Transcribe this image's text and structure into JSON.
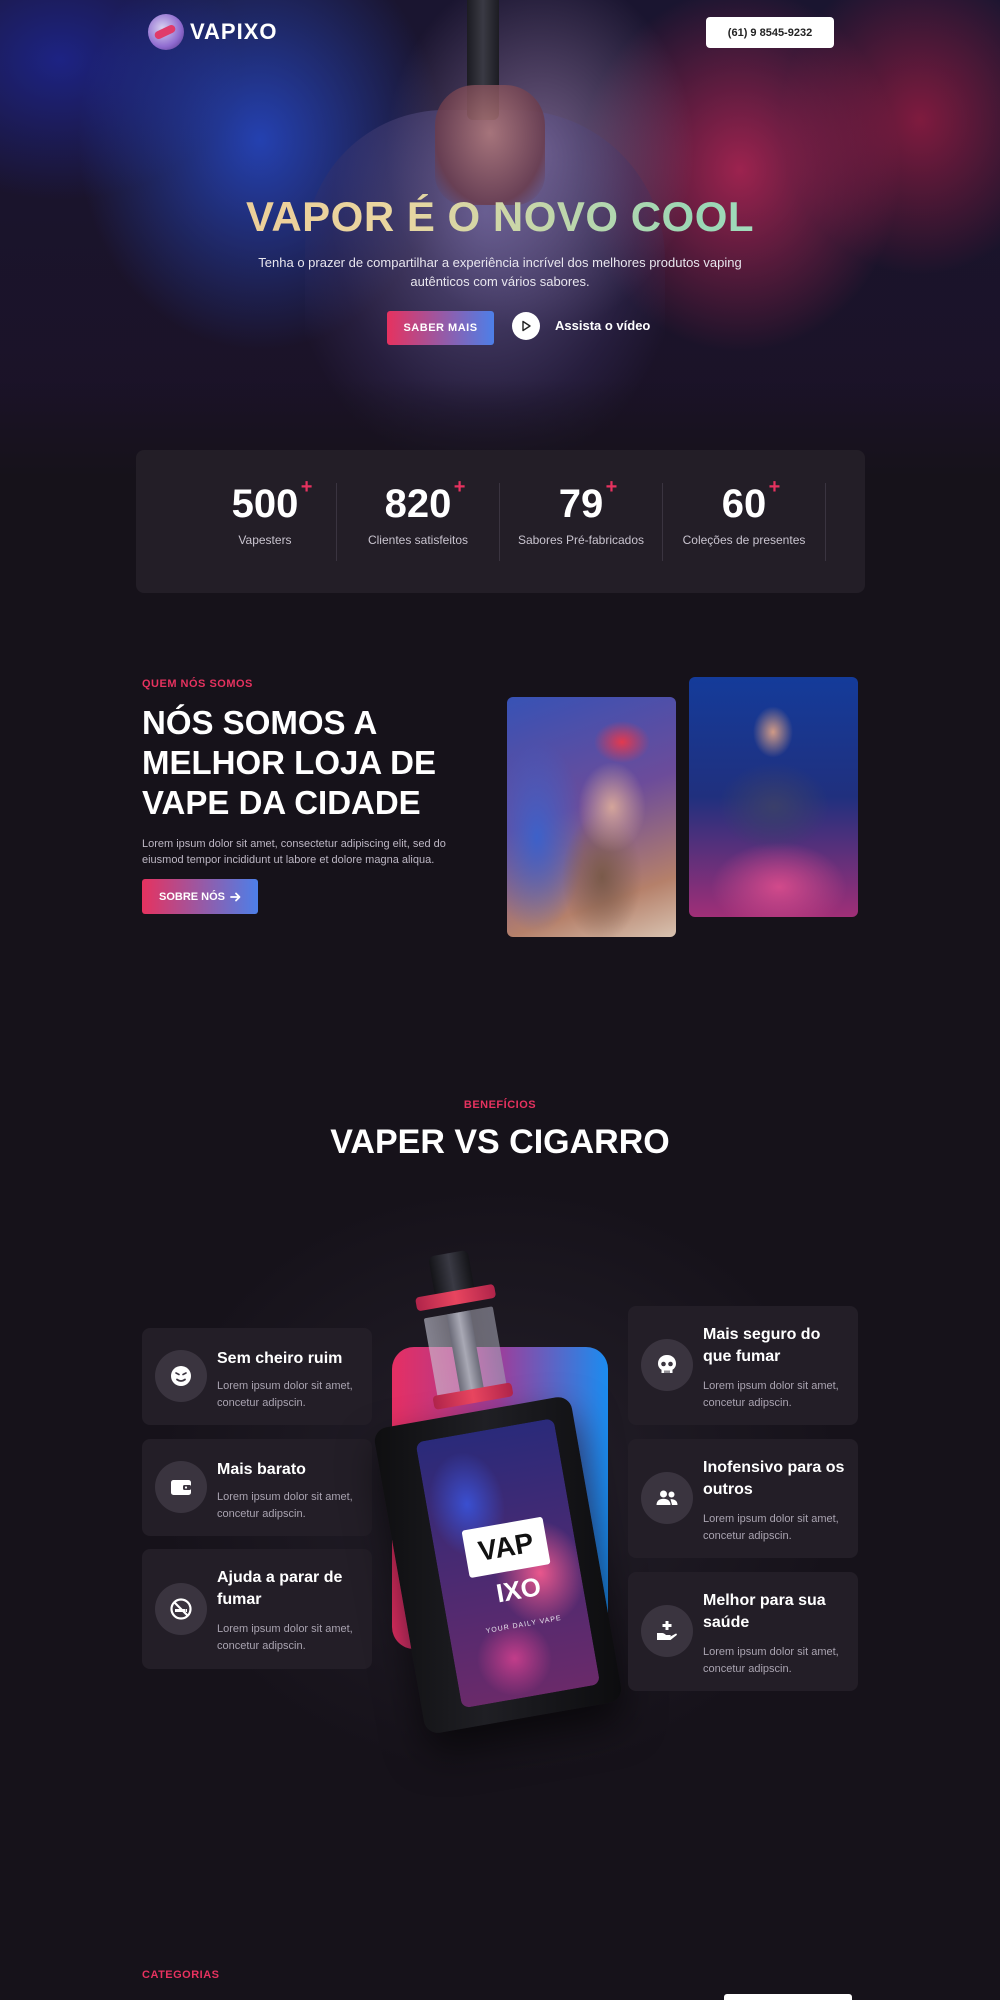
{
  "brand": {
    "name": "VAPIXO",
    "phone": "(61) 9 8545-9232"
  },
  "hero": {
    "title": "VAPOR É O NOVO COOL",
    "subtitle": "Tenha o prazer de compartilhar a experiência incrível dos melhores produtos vaping autênticos com vários sabores.",
    "cta_label": "SABER MAIS",
    "video_label": "Assista o vídeo"
  },
  "stats": [
    {
      "value": "500",
      "suffix": "+",
      "label": "Vapesters"
    },
    {
      "value": "820",
      "suffix": "+",
      "label": "Clientes satisfeitos"
    },
    {
      "value": "79",
      "suffix": "+",
      "label": "Sabores Pré-fabricados"
    },
    {
      "value": "60",
      "suffix": "+",
      "label": "Coleções de presentes"
    }
  ],
  "about": {
    "eyebrow": "QUEM NÓS SOMOS",
    "title": "NÓS SOMOS A MELHOR LOJA DE VAPE DA CIDADE",
    "text": "Lorem ipsum dolor sit amet, consectetur adipiscing elit, sed do eiusmod tempor incididunt ut labore et dolore magna aliqua.",
    "button_label": "SOBRE NÓS"
  },
  "benefits": {
    "eyebrow": "BENEFÍCIOS",
    "title": "VAPER VS CIGARRO",
    "left": [
      {
        "title": "Sem cheiro ruim",
        "text": "Lorem ipsum dolor sit amet, concetur adipscin.",
        "icon": "face-icon"
      },
      {
        "title": "Mais barato",
        "text": "Lorem ipsum dolor sit amet, concetur adipscin.",
        "icon": "wallet-icon"
      },
      {
        "title": "Ajuda a parar de fumar",
        "text": "Lorem ipsum dolor sit amet, concetur adipscin.",
        "icon": "no-smoking-icon"
      }
    ],
    "right": [
      {
        "title": "Mais seguro do que fumar",
        "text": "Lorem ipsum dolor sit amet, concetur adipscin.",
        "icon": "skull-icon"
      },
      {
        "title": "Inofensivo para os outros",
        "text": "Lorem ipsum dolor sit amet, concetur adipscin.",
        "icon": "users-icon"
      },
      {
        "title": "Melhor para sua saúde",
        "text": "Lorem ipsum dolor sit amet, concetur adipscin.",
        "icon": "health-hand-icon"
      }
    ],
    "device_brand_top": "VAP",
    "device_brand_bottom": "IXO",
    "device_tagline": "YOUR DAILY VAPE"
  },
  "categories": {
    "eyebrow": "CATEGORIAS"
  },
  "colors": {
    "accent_pink": "#e6325f",
    "accent_blue": "#4d7fe8",
    "background": "#16121a",
    "card": "#231e27"
  }
}
